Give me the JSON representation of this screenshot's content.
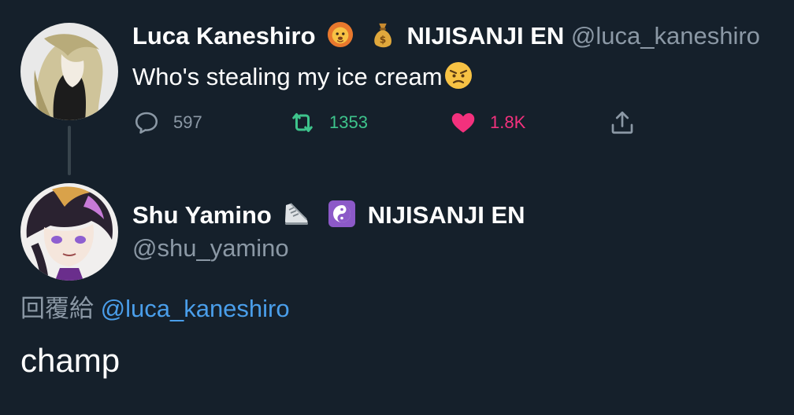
{
  "tweet": {
    "author_name": "Luca Kaneshiro",
    "author_affiliation": "NIJISANJI EN",
    "author_handle": "@luca_kaneshiro",
    "text": "Who's stealing my ice cream",
    "emoji_icons": [
      "lion-face-icon",
      "money-bag-icon",
      "angry-face-icon"
    ],
    "stats": {
      "replies": "597",
      "retweets": "1353",
      "likes": "1.8K"
    }
  },
  "reply": {
    "author_name": "Shu Yamino",
    "author_affiliation": "NIJISANJI EN",
    "author_handle": "@shu_yamino",
    "emoji_icons": [
      "sneaker-icon",
      "yin-yang-icon"
    ],
    "replying_to_label": "回覆給",
    "replying_to_handle": "@luca_kaneshiro",
    "text": "champ"
  },
  "colors": {
    "background": "#15202b",
    "secondary_text": "#8b98a5",
    "retweet_green": "#3ec48c",
    "like_pink": "#f3317d",
    "link_blue": "#4a9eea"
  }
}
